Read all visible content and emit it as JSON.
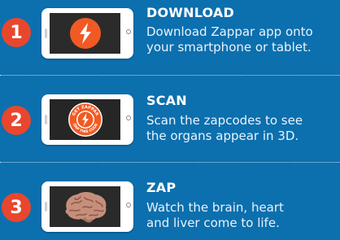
{
  "steps": [
    {
      "number": "1",
      "title": "DOWNLOAD",
      "desc_line1": "Download Zappar app onto",
      "desc_line2": "your smartphone or tablet."
    },
    {
      "number": "2",
      "title": "SCAN",
      "desc_line1": "Scan the zapcodes to see",
      "desc_line2": "the organs appear in 3D."
    },
    {
      "number": "3",
      "title": "ZAP",
      "desc_line1": "Watch the brain, heart",
      "desc_line2": "and liver come to life."
    }
  ],
  "zapcode": {
    "ring_text_top": "GET ZAPPAR",
    "ring_text_bottom": "ZAP THIS CODE"
  },
  "colors": {
    "background": "#0c6fae",
    "badge": "#e8472d",
    "zappar_orange": "#f15a24"
  },
  "icons": {
    "step1_screen": "zappar-logo-icon",
    "step2_screen": "zapcode-icon",
    "step3_screen": "brain-icon"
  }
}
